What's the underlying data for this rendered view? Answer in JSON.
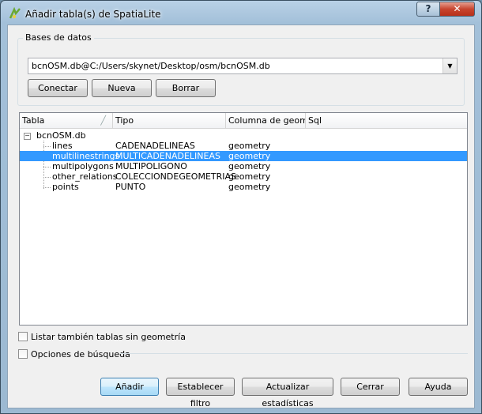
{
  "window": {
    "title": "Añadir tabla(s) de SpatiaLite",
    "help_label": "?",
    "close_label": "✕",
    "app_icon": "qgis-icon"
  },
  "database_group": {
    "label": "Bases de datos",
    "selected": "bcnOSM.db@C:/Users/skynet/Desktop/osm/bcnOSM.db",
    "buttons": {
      "connect": "Conectar",
      "new": "Nueva",
      "delete": "Borrar"
    }
  },
  "table": {
    "columns": [
      "Tabla",
      "Tipo",
      "Columna de geome",
      "Sql"
    ],
    "root": {
      "name": "bcnOSM.db",
      "expander": "−"
    },
    "rows": [
      {
        "name": "lines",
        "type": "CADENADELINEAS",
        "geom_column": "geometry",
        "selected": false
      },
      {
        "name": "multilinestrings",
        "type": "MULTICADENADELINEAS",
        "geom_column": "geometry",
        "selected": true
      },
      {
        "name": "multipolygons",
        "type": "MULTIPOLIGONO",
        "geom_column": "geometry",
        "selected": false
      },
      {
        "name": "other_relations",
        "type": "COLECCIONDEGEOMETRIAS",
        "geom_column": "geometry",
        "selected": false
      },
      {
        "name": "points",
        "type": "PUNTO",
        "geom_column": "geometry",
        "selected": false
      }
    ]
  },
  "options": {
    "list_without_geometry": {
      "label": "Listar también tablas sin geometría",
      "checked": false
    },
    "search_options": {
      "label": "Opciones de búsqueda",
      "checked": false
    }
  },
  "footer": {
    "add": "Añadir",
    "set_filter": "Establecer filtro",
    "update_stats": "Actualizar estadísticas",
    "close": "Cerrar",
    "help": "Ayuda"
  }
}
